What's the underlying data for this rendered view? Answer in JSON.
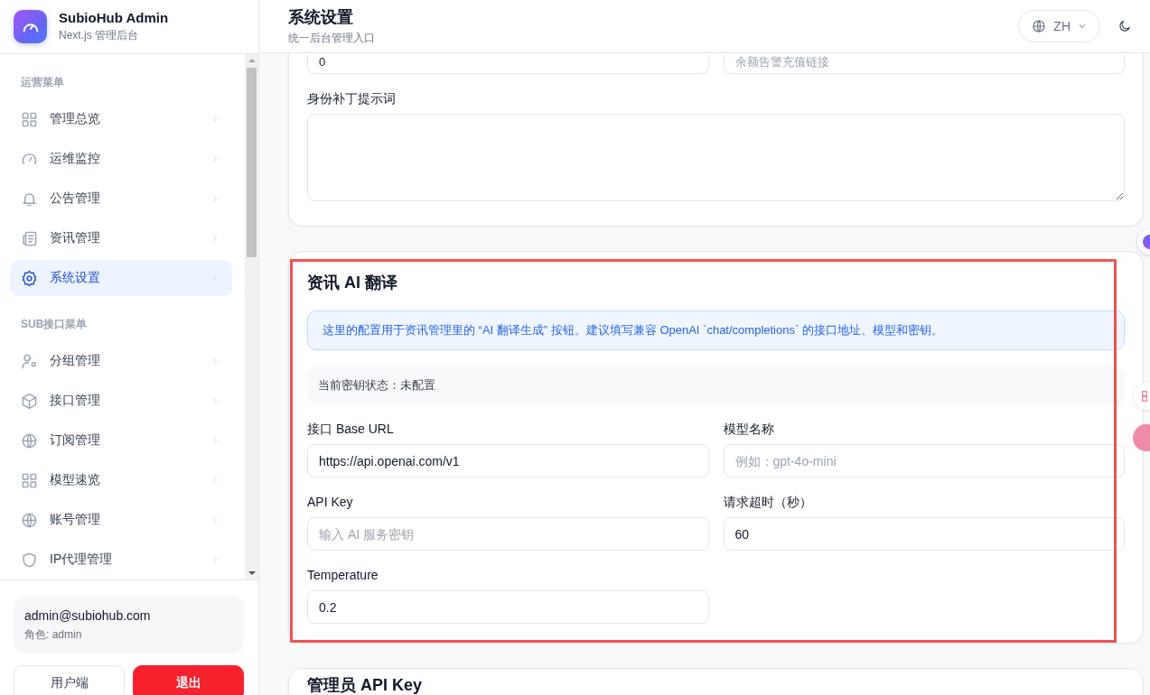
{
  "app": {
    "name": "SubioHub Admin",
    "subtitle": "Next.js 管理后台"
  },
  "sidebar": {
    "sections": [
      {
        "title": "运营菜单",
        "items": [
          {
            "label": "管理总览",
            "selected": false
          },
          {
            "label": "运维监控",
            "selected": false
          },
          {
            "label": "公告管理",
            "selected": false
          },
          {
            "label": "资讯管理",
            "selected": false
          },
          {
            "label": "系统设置",
            "selected": true
          }
        ]
      },
      {
        "title": "SUB接口菜单",
        "items": [
          {
            "label": "分组管理",
            "selected": false
          },
          {
            "label": "接口管理",
            "selected": false
          },
          {
            "label": "订阅管理",
            "selected": false
          },
          {
            "label": "模型速览",
            "selected": false
          },
          {
            "label": "账号管理",
            "selected": false
          },
          {
            "label": "IP代理管理",
            "selected": false
          }
        ]
      }
    ]
  },
  "user": {
    "email": "admin@subiohub.com",
    "role": "角色: admin"
  },
  "footer_buttons": [
    {
      "label": "用户端",
      "kind": "secondary"
    },
    {
      "label": "退出",
      "kind": "danger"
    }
  ],
  "header": {
    "title": "系统设置",
    "subtitle": "统一后台管理入口",
    "language": "ZH",
    "expanded": false
  },
  "cards": [
    {
      "highlighted": false,
      "blocks": [
        {
          "kind": "fields",
          "fields": [
            {
              "value": "0"
            },
            {
              "placeholder": "余额告警充值链接"
            }
          ]
        },
        {
          "kind": "textarea",
          "label": "身份补丁提示词"
        }
      ]
    },
    {
      "title": "资讯 AI 翻译",
      "highlighted": true,
      "blocks": [
        {
          "kind": "info",
          "text": "这里的配置用于资讯管理里的 “AI 翻译生成” 按钮。建议填写兼容 OpenAI `chat/completions` 的接口地址、模型和密钥。"
        },
        {
          "kind": "status",
          "text": "当前密钥状态：未配置"
        },
        {
          "kind": "fields",
          "fields": [
            {
              "label": "接口 Base URL",
              "value": "https://api.openai.com/v1"
            },
            {
              "label": "模型名称",
              "placeholder": "例如：gpt-4o-mini"
            },
            {
              "label": "API Key",
              "placeholder": "输入 AI 服务密钥"
            },
            {
              "label": "请求超时（秒）",
              "value": "60"
            },
            {
              "label": "Temperature",
              "value": "0.2"
            }
          ]
        }
      ]
    },
    {
      "title": "管理员 API Key",
      "highlighted": false
    }
  ]
}
